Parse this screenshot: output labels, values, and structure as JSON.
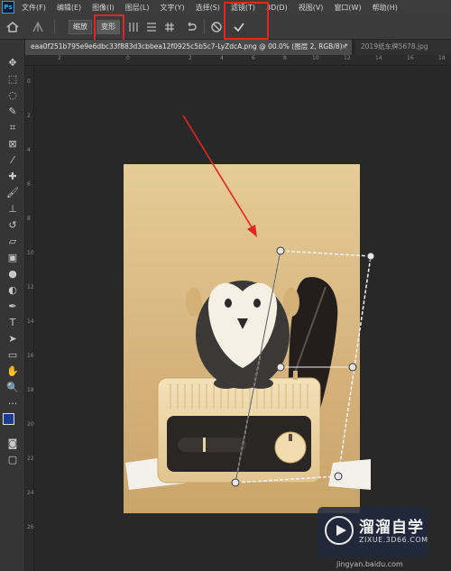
{
  "app": {
    "logo_text": "Ps"
  },
  "menu": {
    "items": [
      "文件(F)",
      "编辑(E)",
      "图像(I)",
      "图层(L)",
      "文字(Y)",
      "选择(S)",
      "滤镜(T)",
      "3D(D)",
      "视图(V)",
      "窗口(W)",
      "帮助(H)"
    ]
  },
  "options_bar": {
    "normal_label": "缩放",
    "warp_label": "变形",
    "commit_icon": "checkmark-icon",
    "cancel_icon": "cancel-icon",
    "undo_icon": "undo-icon"
  },
  "tabs": [
    {
      "label": "eaa0f251b795e9e6dbc33f883d3cbbea12f0925c5b5c7-LyZdcA.png @ 00.0% (图层 2, RGB/8) *",
      "active": true
    },
    {
      "label": "2019纸车牌5678.jpg",
      "active": false
    }
  ],
  "tab_close_glyph": "×",
  "ruler": {
    "top_ticks": [
      "2",
      "0",
      "2",
      "4",
      "6",
      "8",
      "10",
      "12",
      "14",
      "16",
      "18"
    ],
    "left_ticks": [
      "0",
      "2",
      "4",
      "6",
      "8",
      "10",
      "12",
      "14",
      "16",
      "18",
      "20",
      "22",
      "24",
      "26"
    ]
  },
  "toolbar": {
    "tools": [
      "move-tool",
      "marquee-tool",
      "lasso-tool",
      "quick-select-tool",
      "crop-tool",
      "frame-tool",
      "eyedropper-tool",
      "healing-tool",
      "brush-tool",
      "clone-stamp-tool",
      "history-brush-tool",
      "eraser-tool",
      "gradient-tool",
      "blur-tool",
      "dodge-tool",
      "pen-tool",
      "type-tool",
      "path-select-tool",
      "rectangle-tool",
      "hand-tool",
      "zoom-tool",
      "more-tools",
      "foreground-background-colors",
      "quick-mask",
      "screen-mode"
    ],
    "foreground_color": "#1c3d8c",
    "background_color": "#ffffff"
  },
  "colors": {
    "highlight_box": "#e3261f",
    "arrow": "#e3261f",
    "canvas_bg": "#282828",
    "artwork_bg": "#d9b97a"
  },
  "watermark": {
    "title": "溜溜自学",
    "url": "ZIXUE.3D66.COM",
    "footer_url": "jingyan.baidu.com"
  }
}
